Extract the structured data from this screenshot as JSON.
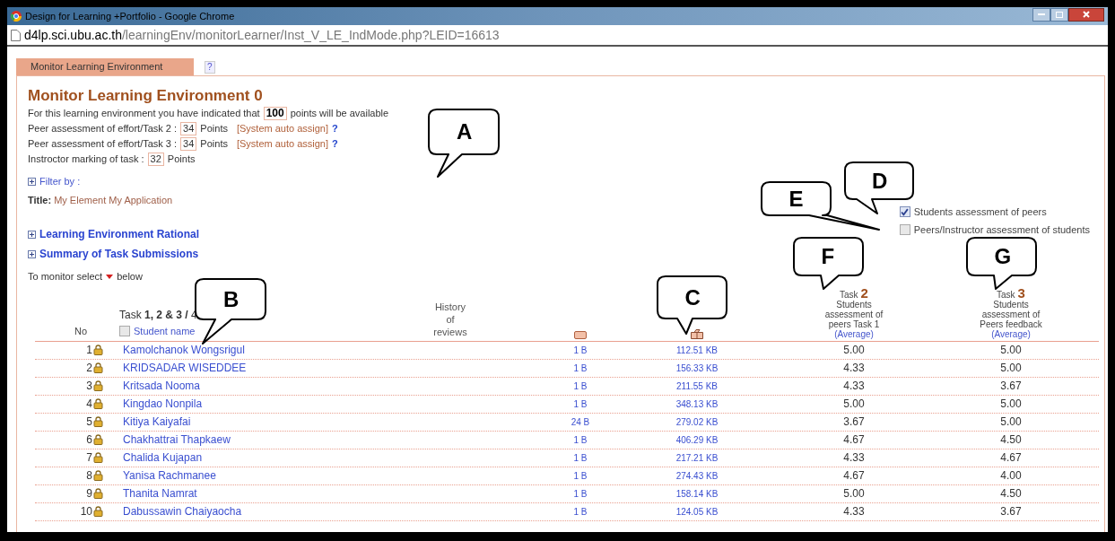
{
  "window": {
    "title": "Design for Learning +Portfolio - Google Chrome",
    "url_host": "d4lp.sci.ubu.ac.th",
    "url_path": "/learningEnv/monitorLearner/Inst_V_LE_IndMode.php?LEID=16613"
  },
  "tabs": [
    {
      "label": "Monitor Learning Environment",
      "selected": true
    }
  ],
  "tab_help": "?",
  "heading": "Monitor Learning Environment 0",
  "points_lines": [
    {
      "label": "For this learning environment you have indicated that",
      "value": "100",
      "bold": true,
      "suffix": "points will be available"
    },
    {
      "label": "Peer assessment of effort/Task 2 :",
      "value": "34",
      "bold": false,
      "suffix": "Points",
      "note": "[System auto assign]",
      "help": "?"
    },
    {
      "label": "Peer assessment of effort/Task 3 :",
      "value": "34",
      "bold": false,
      "suffix": "Points",
      "note": "[System auto assign]",
      "help": "?"
    },
    {
      "label": "Instroctor marking of task :",
      "value": "32",
      "bold": false,
      "suffix": "Points"
    }
  ],
  "filter": {
    "label": "Filter by :",
    "expanded": false
  },
  "title_line": {
    "label": "Title:",
    "value": "My Element My Application"
  },
  "sections": [
    {
      "label": "Learning Environment Rational",
      "expanded": false
    },
    {
      "label": "Summary of Task Submissions",
      "expanded": false
    }
  ],
  "monitor_hint": {
    "before": "To monitor select",
    "after": "below"
  },
  "legend": [
    {
      "label": "Students assessment of peers",
      "checked": true
    },
    {
      "label": "Peers/Instructor assessment of students",
      "checked": false
    }
  ],
  "table": {
    "no_header": "No",
    "task_header": "Task **1, 2 & 3 /** 4",
    "select_all_checked": false,
    "name_header": "Student name",
    "history_header": "History of reviews",
    "task_columns": [
      {
        "task": "Task",
        "number": "2",
        "description": "Students assessment of peers Task 1",
        "link": "(Average)"
      },
      {
        "task": "Task",
        "number": "3",
        "description": "Students assessment of Peers feedback",
        "link": "(Average)"
      }
    ],
    "rows": [
      {
        "no": "1",
        "name": "Kamolchanok Wongsrigul",
        "column_3": "1 B",
        "column_4": "112.51 KB",
        "task_2": "5.00",
        "task_3": "5.00"
      },
      {
        "no": "2",
        "name": "KRIDSADAR WISEDDEE",
        "column_3": "1 B",
        "column_4": "156.33 KB",
        "task_2": "4.33",
        "task_3": "5.00"
      },
      {
        "no": "3",
        "name": "Kritsada Nooma",
        "column_3": "1 B",
        "column_4": "211.55 KB",
        "task_2": "4.33",
        "task_3": "3.67"
      },
      {
        "no": "4",
        "name": "Kingdao Nonpila",
        "column_3": "1 B",
        "column_4": "348.13 KB",
        "task_2": "5.00",
        "task_3": "5.00"
      },
      {
        "no": "5",
        "name": "Kitiya Kaiyafai",
        "column_3": "24 B",
        "column_4": "279.02 KB",
        "task_2": "3.67",
        "task_3": "5.00"
      },
      {
        "no": "6",
        "name": "Chakhattrai Thapkaew",
        "column_3": "1 B",
        "column_4": "406.29 KB",
        "task_2": "4.67",
        "task_3": "4.50"
      },
      {
        "no": "7",
        "name": "Chalida Kujapan",
        "column_3": "1 B",
        "column_4": "217.21 KB",
        "task_2": "4.33",
        "task_3": "4.67"
      },
      {
        "no": "8",
        "name": "Yanisa Rachmanee",
        "column_3": "1 B",
        "column_4": "274.43 KB",
        "task_2": "4.67",
        "task_3": "4.00"
      },
      {
        "no": "9",
        "name": "Thanita Namrat",
        "column_3": "1 B",
        "column_4": "158.14 KB",
        "task_2": "5.00",
        "task_3": "4.50"
      },
      {
        "no": "10",
        "name": "Dabussawin Chaiyaocha",
        "column_3": "1 B",
        "column_4": "124.05 KB",
        "task_2": "4.33",
        "task_3": "3.67"
      }
    ]
  },
  "callouts": [
    {
      "letter": "A"
    },
    {
      "letter": "B"
    },
    {
      "letter": "C"
    },
    {
      "letter": "D"
    },
    {
      "letter": "E"
    },
    {
      "letter": "F"
    },
    {
      "letter": "G"
    }
  ]
}
